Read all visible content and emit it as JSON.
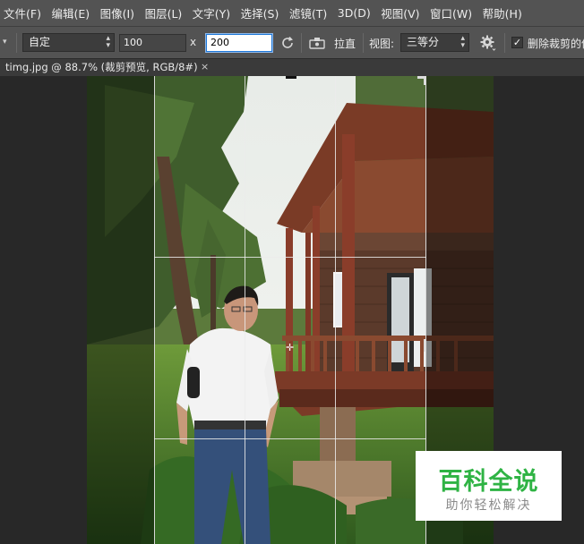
{
  "menubar": {
    "items": [
      "文件(F)",
      "编辑(E)",
      "图像(I)",
      "图层(L)",
      "文字(Y)",
      "选择(S)",
      "滤镜(T)",
      "3D(D)",
      "视图(V)",
      "窗口(W)",
      "帮助(H)"
    ]
  },
  "options": {
    "ratio_select": "自定",
    "width_value": "100",
    "x_label": "x",
    "height_value": "200",
    "straighten_label": "拉直",
    "view_label": "视图:",
    "view_select": "三等分",
    "delete_cropped_label": "删除裁剪的像",
    "delete_cropped_checked": true,
    "icons": {
      "reset": "rotate-icon",
      "straighten": "level-icon",
      "settings": "gear-icon"
    }
  },
  "tab": {
    "title": "timg.jpg @ 88.7% (裁剪预览, RGB/8#)",
    "close": "×"
  },
  "watermark": {
    "title": "百科全说",
    "subtitle": "助你轻松解决"
  },
  "colors": {
    "accent_underline": "#d0282e",
    "watermark_green": "#2fb344"
  }
}
